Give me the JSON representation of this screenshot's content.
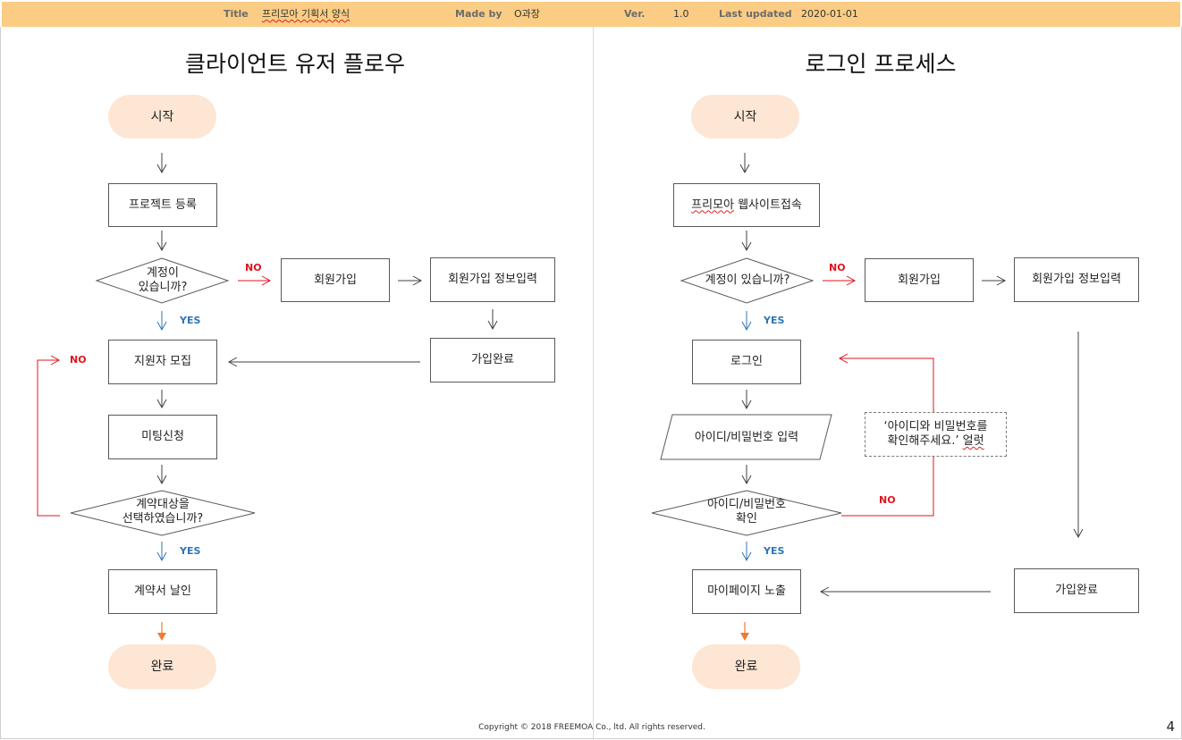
{
  "header": {
    "title_label": "Title",
    "title_value": "프리모아 기획서 양식",
    "made_by_label": "Made by",
    "made_by_value": "O과장",
    "ver_label": "Ver.",
    "ver_value": "1.0",
    "updated_label": "Last updated",
    "updated_value": "2020-01-01"
  },
  "left": {
    "title": "클라이언트 유저 플로우",
    "start": "시작",
    "register_project": "프로젝트 등록",
    "has_account_1": "계정이",
    "has_account_2": "있습니까?",
    "signup": "회원가입",
    "signup_info": "회원가입 정보입력",
    "signup_done": "가입완료",
    "recruit": "지원자 모집",
    "meeting": "미팅신청",
    "select_target_1": "계약대상을",
    "select_target_2": "선택하였습니까?",
    "contract": "계약서 날인",
    "end": "완료",
    "no_label_1": "NO",
    "yes_label_1": "YES",
    "no_label_2": "NO",
    "yes_label_2": "YES"
  },
  "right": {
    "title": "로그인 프로세스",
    "start": "시작",
    "visit_site": "프리모아 웹사이트접속",
    "visit_site_underlined": "프리모아",
    "visit_site_rest": " 웹사이트접속",
    "has_account": "계정이 있습니까?",
    "signup": "회원가입",
    "signup_info": "회원가입 정보입력",
    "signup_done": "가입완료",
    "login": "로그인",
    "input_credentials": "아이디/비밀번호 입력",
    "verify_1": "아이디/비밀번호",
    "verify_2": "확인",
    "mypage": "마이페이지 노출",
    "end": "완료",
    "note_1": "‘아이디와 비밀번호를",
    "note_2a": "확인해주세요.’ ",
    "note_2b": "얼럿",
    "no_label_1": "NO",
    "yes_label_1": "YES",
    "no_label_2": "NO",
    "yes_label_2": "YES"
  },
  "footer": {
    "copyright": "Copyright © 2018 FREEMOA Co., ltd. All rights reserved.",
    "page_number": "4"
  },
  "colors": {
    "header_bg": "#fbcd84",
    "terminal_fill": "#fde6d4",
    "no_arrow": "#e0141e",
    "yes_arrow": "#2e75b6",
    "end_arrow": "#ed7d31",
    "flow_arrow": "#404040"
  }
}
